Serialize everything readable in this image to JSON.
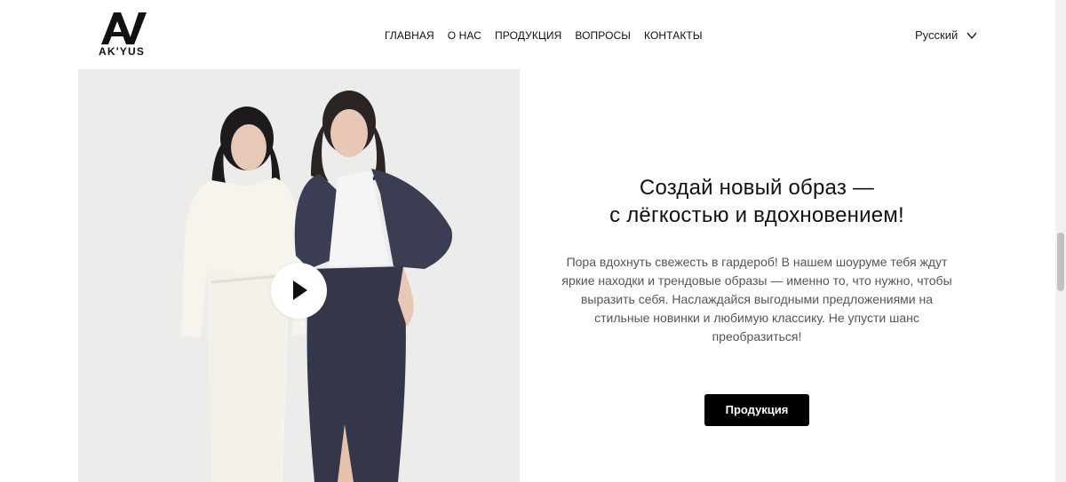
{
  "header": {
    "logo_text": "AK'YUS",
    "nav": [
      {
        "label": "ГЛАВНАЯ"
      },
      {
        "label": "О НАС"
      },
      {
        "label": "ПРОДУКЦИЯ"
      },
      {
        "label": "ВОПРОСЫ"
      },
      {
        "label": "КОНТАКТЫ"
      }
    ],
    "language": "Русский"
  },
  "hero": {
    "headline_line1": "Создай новый образ —",
    "headline_line2": "с лёгкостью и вдохновением!",
    "description": "Пора вдохнуть свежесть в гардероб! В нашем шоуруме тебя ждут яркие находки и трендовые образы — именно то, что нужно, чтобы выразить себя. Наслаждайся выгодными предложениями на стильные новинки и любимую классику. Не упусти шанс преобразиться!",
    "cta_label": "Продукция"
  },
  "colors": {
    "accent": "#000000",
    "text": "#111111",
    "muted": "#555555",
    "image_bg": "#ececeb"
  }
}
